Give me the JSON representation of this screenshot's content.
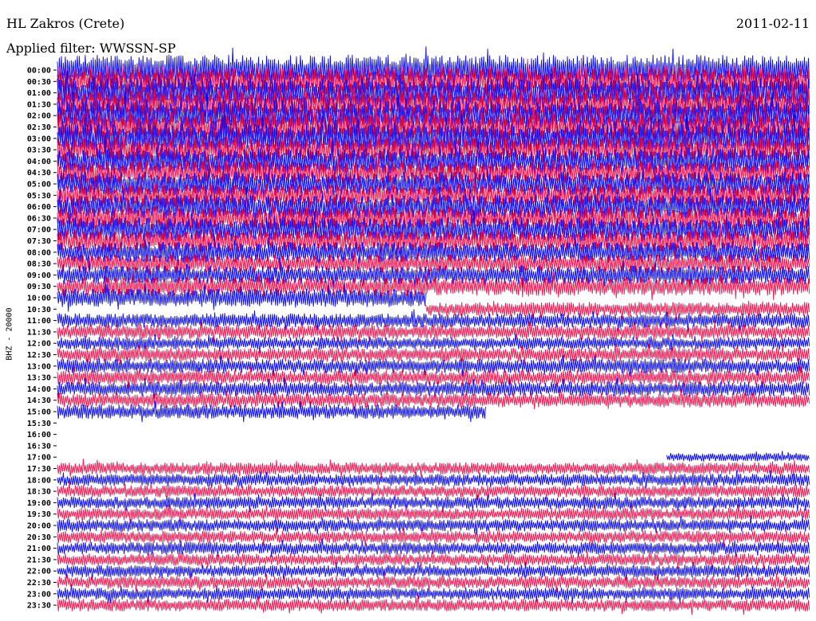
{
  "header": {
    "station": "HL Zakros (Crete)",
    "date": "2011-02-11",
    "filter": "Applied filter: WWSSN-SP"
  },
  "colors": {
    "trace_a": "#0a0aee",
    "trace_b": "#ee1550"
  },
  "chart_data": {
    "type": "line",
    "title": "HL Zakros (Crete)",
    "date": "2011-02-11",
    "filter": "WWSSN-SP",
    "ylabel": "BHZ - 20000",
    "xlabel": "",
    "rows": [
      {
        "time": "00:00",
        "start": 0.0,
        "end": 1.0,
        "amp": 3.0
      },
      {
        "time": "00:30",
        "start": 0.0,
        "end": 1.0,
        "amp": 3.0
      },
      {
        "time": "01:00",
        "start": 0.0,
        "end": 1.0,
        "amp": 3.0
      },
      {
        "time": "01:30",
        "start": 0.0,
        "end": 1.0,
        "amp": 3.0
      },
      {
        "time": "02:00",
        "start": 0.0,
        "end": 1.0,
        "amp": 3.0
      },
      {
        "time": "02:30",
        "start": 0.0,
        "end": 1.0,
        "amp": 3.0
      },
      {
        "time": "03:00",
        "start": 0.0,
        "end": 1.0,
        "amp": 3.0
      },
      {
        "time": "03:30",
        "start": 0.0,
        "end": 1.0,
        "amp": 2.6
      },
      {
        "time": "04:00",
        "start": 0.0,
        "end": 1.0,
        "amp": 2.6
      },
      {
        "time": "04:30",
        "start": 0.0,
        "end": 1.0,
        "amp": 2.4
      },
      {
        "time": "05:00",
        "start": 0.0,
        "end": 1.0,
        "amp": 2.4
      },
      {
        "time": "05:30",
        "start": 0.0,
        "end": 1.0,
        "amp": 2.4
      },
      {
        "time": "06:00",
        "start": 0.0,
        "end": 1.0,
        "amp": 2.4
      },
      {
        "time": "06:30",
        "start": 0.0,
        "end": 1.0,
        "amp": 2.4
      },
      {
        "time": "07:00",
        "start": 0.0,
        "end": 1.0,
        "amp": 2.4
      },
      {
        "time": "07:30",
        "start": 0.0,
        "end": 1.0,
        "amp": 2.2
      },
      {
        "time": "08:00",
        "start": 0.0,
        "end": 1.0,
        "amp": 2.0
      },
      {
        "time": "08:30",
        "start": 0.0,
        "end": 1.0,
        "amp": 1.8
      },
      {
        "time": "09:00",
        "start": 0.0,
        "end": 1.0,
        "amp": 1.8
      },
      {
        "time": "09:30",
        "start": 0.0,
        "end": 1.0,
        "amp": 1.8
      },
      {
        "time": "10:00",
        "start": 0.0,
        "end": 0.49,
        "amp": 1.8
      },
      {
        "time": "10:30",
        "start": 0.49,
        "end": 1.0,
        "amp": 1.4
      },
      {
        "time": "11:00",
        "start": 0.0,
        "end": 1.0,
        "amp": 1.4
      },
      {
        "time": "11:30",
        "start": 0.0,
        "end": 1.0,
        "amp": 1.4
      },
      {
        "time": "12:00",
        "start": 0.0,
        "end": 1.0,
        "amp": 1.2
      },
      {
        "time": "12:30",
        "start": 0.0,
        "end": 1.0,
        "amp": 1.4
      },
      {
        "time": "13:00",
        "start": 0.0,
        "end": 1.0,
        "amp": 1.4
      },
      {
        "time": "13:30",
        "start": 0.0,
        "end": 1.0,
        "amp": 1.4
      },
      {
        "time": "14:00",
        "start": 0.0,
        "end": 1.0,
        "amp": 1.4
      },
      {
        "time": "14:30",
        "start": 0.0,
        "end": 1.0,
        "amp": 1.4
      },
      {
        "time": "15:00",
        "start": 0.0,
        "end": 0.57,
        "amp": 1.4
      },
      {
        "time": "15:30",
        "start": 0.0,
        "end": 0.0,
        "amp": 0
      },
      {
        "time": "16:00",
        "start": 0.0,
        "end": 0.0,
        "amp": 0
      },
      {
        "time": "16:30",
        "start": 0.0,
        "end": 0.0,
        "amp": 0
      },
      {
        "time": "17:00",
        "start": 0.81,
        "end": 1.0,
        "amp": 0.8
      },
      {
        "time": "17:30",
        "start": 0.0,
        "end": 1.0,
        "amp": 1.2
      },
      {
        "time": "18:00",
        "start": 0.0,
        "end": 1.0,
        "amp": 1.2
      },
      {
        "time": "18:30",
        "start": 0.0,
        "end": 1.0,
        "amp": 1.2
      },
      {
        "time": "19:00",
        "start": 0.0,
        "end": 1.0,
        "amp": 1.2
      },
      {
        "time": "19:30",
        "start": 0.0,
        "end": 1.0,
        "amp": 1.2
      },
      {
        "time": "20:00",
        "start": 0.0,
        "end": 1.0,
        "amp": 1.2
      },
      {
        "time": "20:30",
        "start": 0.0,
        "end": 1.0,
        "amp": 1.2
      },
      {
        "time": "21:00",
        "start": 0.0,
        "end": 1.0,
        "amp": 1.2
      },
      {
        "time": "21:30",
        "start": 0.0,
        "end": 1.0,
        "amp": 1.2
      },
      {
        "time": "22:00",
        "start": 0.0,
        "end": 1.0,
        "amp": 1.2
      },
      {
        "time": "22:30",
        "start": 0.0,
        "end": 1.0,
        "amp": 1.2
      },
      {
        "time": "23:00",
        "start": 0.0,
        "end": 1.0,
        "amp": 1.2
      },
      {
        "time": "23:30",
        "start": 0.0,
        "end": 1.0,
        "amp": 1.2
      }
    ]
  }
}
